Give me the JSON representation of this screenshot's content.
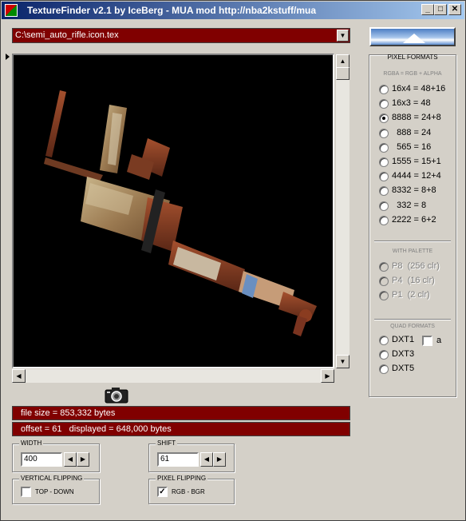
{
  "window": {
    "title": "TextureFinder v2.1 by IceBerg - MUA mod http://nba2kstuff/mua",
    "min_glyph": "_",
    "max_glyph": "□",
    "close_glyph": "✕"
  },
  "file_select": {
    "value": "C:\\semi_auto_rifle.icon.tex"
  },
  "info": {
    "file_size": "file size = 853,332 bytes",
    "offset_line": "offset = 61   displayed = 648,000 bytes"
  },
  "width_group": {
    "label": "WIDTH",
    "value": "400"
  },
  "shift_group": {
    "label": "SHIFT",
    "value": "61"
  },
  "vertical_flip": {
    "label": "VERTICAL FLIPPING",
    "option": "TOP - DOWN",
    "checked": false
  },
  "pixel_flip": {
    "label": "PIXEL FLIPPING",
    "option": "RGB  -  BGR",
    "checked": true
  },
  "panel": {
    "title": "PIXEL FORMATS",
    "rgba_note": "RGBA = RGB + ALPHA",
    "formats": [
      {
        "label": "16x4 = 48+16",
        "selected": false
      },
      {
        "label": "16x3 = 48",
        "selected": false
      },
      {
        "label": "8888 = 24+8",
        "selected": true
      },
      {
        "label": "  888 = 24",
        "selected": false
      },
      {
        "label": "  565 = 16",
        "selected": false
      },
      {
        "label": "1555 = 15+1",
        "selected": false
      },
      {
        "label": "4444 = 12+4",
        "selected": false
      },
      {
        "label": "8332 = 8+8",
        "selected": false
      },
      {
        "label": "  332 = 8",
        "selected": false
      },
      {
        "label": "2222 = 6+2",
        "selected": false
      }
    ],
    "palette_title": "WITH PALETTE",
    "palette": [
      {
        "label": "P8  (256 clr)"
      },
      {
        "label": "P4  (16 clr)"
      },
      {
        "label": "P1  (2 clr)"
      }
    ],
    "quad_title": "QUAD FORMATS",
    "quad": [
      {
        "label": "DXT1"
      },
      {
        "label": "DXT3"
      },
      {
        "label": "DXT5"
      }
    ],
    "alpha_label": "a"
  },
  "scroll_glyphs": {
    "up": "▲",
    "down": "▼",
    "left": "◀",
    "right": "▶"
  },
  "combo_glyph": "▼",
  "check_glyph": "✓",
  "icons": [
    "app-icon",
    "camera-icon",
    "iceberg-logo",
    "texture-preview"
  ]
}
